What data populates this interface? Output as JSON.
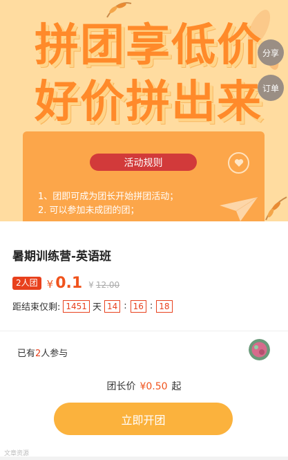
{
  "banner": {
    "headline_line1": "拼团享低价",
    "headline_line2": "好价拼出来",
    "share_label": "分享",
    "order_label": "订单",
    "rules_title": "活动规则",
    "rules": [
      "1、团即可成为团长开始拼团活动；",
      "2. 可以参加未成团的团；"
    ]
  },
  "product": {
    "title": "暑期训练营-英语班",
    "group_badge": "2人团",
    "currency": "¥",
    "price": "0.1",
    "original_price": "12.00"
  },
  "countdown": {
    "prefix": "距结束仅剩:",
    "days": "1451",
    "days_label": "天",
    "hours": "14",
    "minutes": "16",
    "seconds": "18",
    "separator": ":"
  },
  "participants": {
    "prefix": "已有",
    "count": "2",
    "suffix": "人参与"
  },
  "leader": {
    "label": "团长价",
    "price": "¥0.50",
    "suffix": "起"
  },
  "cta_label": "立即开团",
  "watermark": "文章资源",
  "colors": {
    "accent": "#f0531c",
    "button": "#fbb23d",
    "banner_bg": "#ffdca0",
    "card_bg": "#fca64a",
    "pill_red": "#d23a3a"
  }
}
